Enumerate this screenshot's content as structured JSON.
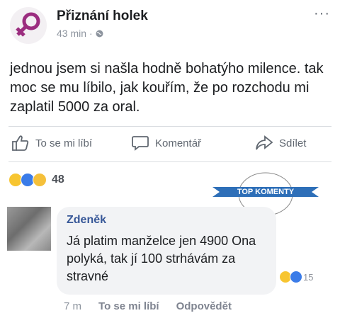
{
  "post": {
    "page_name": "Přiznání holek",
    "time": "43 min",
    "separator": "·",
    "more": "···",
    "text": "jednou jsem si našla hodně bohatýho milence. tak moc se mu líbilo, jak kouřím, že po rozchodu mi zaplatil 5000 za oral."
  },
  "actions": {
    "like": "To se mi líbí",
    "comment": "Komentář",
    "share": "Sdílet"
  },
  "reactions": {
    "count": "48",
    "icons": [
      "haha-icon",
      "like-icon",
      "sad-icon"
    ]
  },
  "top_comments_badge": "TOP KOMENTY",
  "comment": {
    "author": "Zdeněk",
    "text": "Já platim manželce jen 4900 Ona polyká, tak jí 100 strhávám za stravné",
    "reaction_count": "15",
    "time": "7 m",
    "like": "To se mi líbí",
    "reply": "Odpovědět"
  },
  "colors": {
    "accent": "#385898",
    "badge": "#2e6fb8",
    "logo": "#9b2d7f"
  }
}
